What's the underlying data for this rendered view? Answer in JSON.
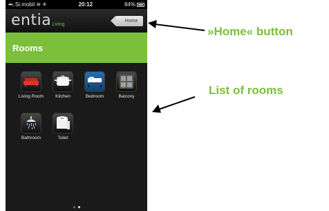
{
  "status": {
    "carrier": "Si.mobil",
    "time": "20:12",
    "battery": "84%"
  },
  "header": {
    "logo_text": "entia",
    "logo_sub": "Living",
    "home_label": "Home"
  },
  "page": {
    "title": "Rooms"
  },
  "rooms": [
    {
      "label": "Living Room",
      "icon": "sofa-icon"
    },
    {
      "label": "Kitchen",
      "icon": "pot-icon"
    },
    {
      "label": "Bedroom",
      "icon": "bed-icon"
    },
    {
      "label": "Balcony",
      "icon": "window-icon"
    },
    {
      "label": "Bathroom",
      "icon": "shower-icon"
    },
    {
      "label": "Toilet",
      "icon": "toilet-paper-icon"
    }
  ],
  "annotations": {
    "home_callout": "»Home« button",
    "rooms_callout": "List of rooms"
  },
  "colors": {
    "accent": "#7bbf3a",
    "background": "#1a1a1a"
  }
}
